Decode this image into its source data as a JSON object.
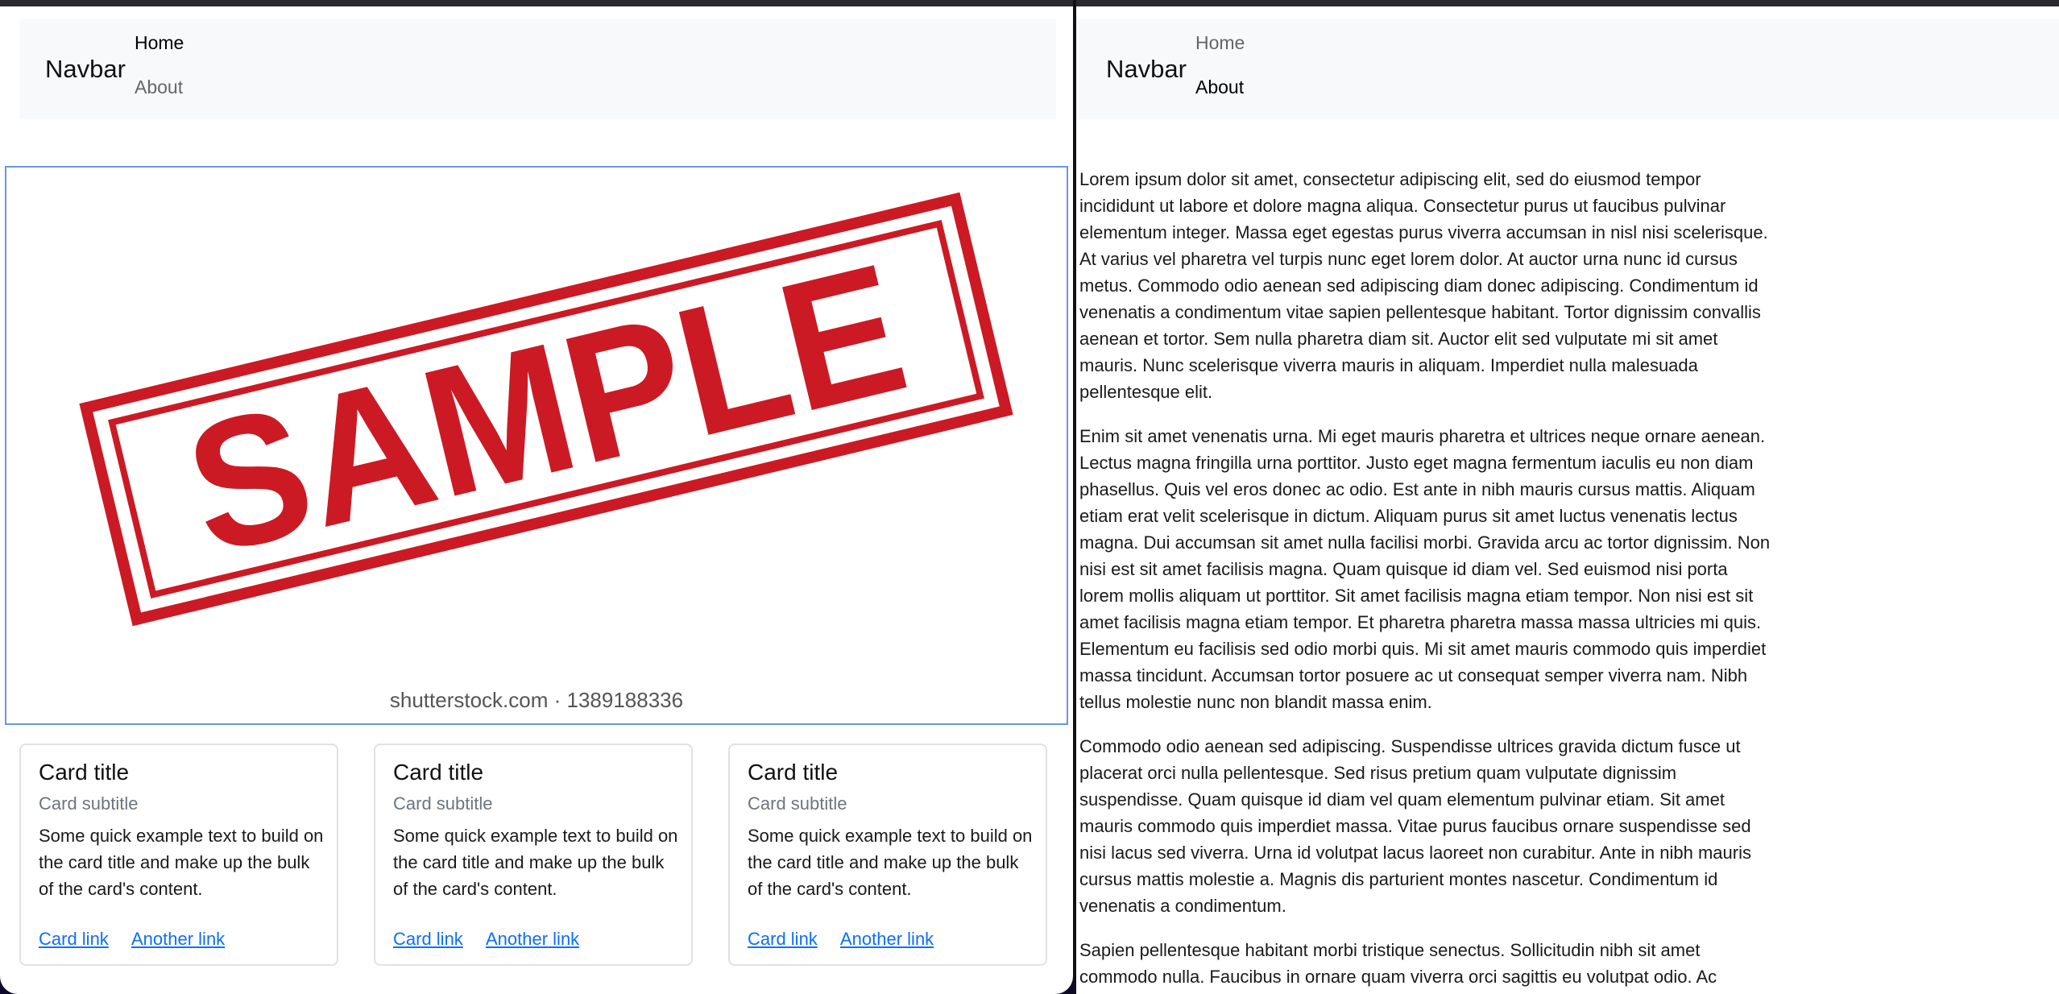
{
  "left_pane": {
    "navbar": {
      "brand": "Navbar",
      "links": [
        {
          "label": "Home",
          "active": true
        },
        {
          "label": "About",
          "active": false
        }
      ]
    },
    "image": {
      "stamp_text": "SAMPLE",
      "watermark": "shutterstock.com · 1389188336",
      "stamp_color": "#cc1a24",
      "outline_color": "#6a96e6"
    },
    "cards": [
      {
        "title": "Card title",
        "subtitle": "Card subtitle",
        "text": "Some quick example text to build on the card title and make up the bulk of the card's content.",
        "link1": "Card link",
        "link2": "Another link"
      },
      {
        "title": "Card title",
        "subtitle": "Card subtitle",
        "text": "Some quick example text to build on the card title and make up the bulk of the card's content.",
        "link1": "Card link",
        "link2": "Another link"
      },
      {
        "title": "Card title",
        "subtitle": "Card subtitle",
        "text": "Some quick example text to build on the card title and make up the bulk of the card's content.",
        "link1": "Card link",
        "link2": "Another link"
      }
    ]
  },
  "right_pane": {
    "navbar": {
      "brand": "Navbar",
      "links": [
        {
          "label": "Home",
          "active": false
        },
        {
          "label": "About",
          "active": true
        }
      ]
    },
    "paragraphs": [
      "Lorem ipsum dolor sit amet, consectetur adipiscing elit, sed do eiusmod tempor incididunt ut labore et dolore magna aliqua. Consectetur purus ut faucibus pulvinar elementum integer. Massa eget egestas purus viverra accumsan in nisl nisi scelerisque. At varius vel pharetra vel turpis nunc eget lorem dolor. At auctor urna nunc id cursus metus. Commodo odio aenean sed adipiscing diam donec adipiscing. Condimentum id venenatis a condimentum vitae sapien pellentesque habitant. Tortor dignissim convallis aenean et tortor. Sem nulla pharetra diam sit. Auctor elit sed vulputate mi sit amet mauris. Nunc scelerisque viverra mauris in aliquam. Imperdiet nulla malesuada pellentesque elit.",
      "Enim sit amet venenatis urna. Mi eget mauris pharetra et ultrices neque ornare aenean. Lectus magna fringilla urna porttitor. Justo eget magna fermentum iaculis eu non diam phasellus. Quis vel eros donec ac odio. Est ante in nibh mauris cursus mattis. Aliquam etiam erat velit scelerisque in dictum. Aliquam purus sit amet luctus venenatis lectus magna. Dui accumsan sit amet nulla facilisi morbi. Gravida arcu ac tortor dignissim. Non nisi est sit amet facilisis magna. Quam quisque id diam vel. Sed euismod nisi porta lorem mollis aliquam ut porttitor. Sit amet facilisis magna etiam tempor. Non nisi est sit amet facilisis magna etiam tempor. Et pharetra pharetra massa massa ultricies mi quis. Elementum eu facilisis sed odio morbi quis. Mi sit amet mauris commodo quis imperdiet massa tincidunt. Accumsan tortor posuere ac ut consequat semper viverra nam. Nibh tellus molestie nunc non blandit massa enim.",
      "Commodo odio aenean sed adipiscing. Suspendisse ultrices gravida dictum fusce ut placerat orci nulla pellentesque. Sed risus pretium quam vulputate dignissim suspendisse. Quam quisque id diam vel quam elementum pulvinar etiam. Sit amet mauris commodo quis imperdiet massa. Vitae purus faucibus ornare suspendisse sed nisi lacus sed viverra. Urna id volutpat lacus laoreet non curabitur. Ante in nibh mauris cursus mattis molestie a. Magnis dis parturient montes nascetur. Condimentum id venenatis a condimentum.",
      "Sapien pellentesque habitant morbi tristique senectus. Sollicitudin nibh sit amet commodo nulla. Faucibus in ornare quam viverra orci sagittis eu volutpat odio. Ac"
    ]
  }
}
